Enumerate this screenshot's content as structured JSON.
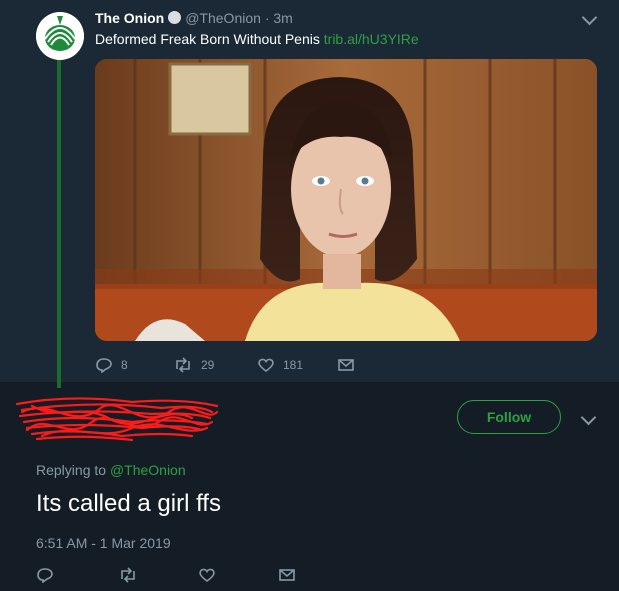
{
  "parent_tweet": {
    "author_name": "The Onion",
    "author_handle": "@TheOnion",
    "separator": "·",
    "time_ago": "3m",
    "text": "Deformed Freak Born Without Penis",
    "link": "trib.al/hU3YIRe",
    "counts": {
      "replies": "8",
      "retweets": "29",
      "likes": "181"
    },
    "icons": [
      "reply-icon",
      "retweet-icon",
      "like-icon",
      "message-icon",
      "verified-badge-icon",
      "chevron-down-icon"
    ]
  },
  "reply_tweet": {
    "follow_label": "Follow",
    "replying_prefix": "Replying to",
    "replying_handle": "@TheOnion",
    "text": "Its called a girl ffs",
    "timestamp": "6:51 AM - 1 Mar 2019",
    "icons": [
      "reply-icon",
      "retweet-icon",
      "like-icon",
      "message-icon",
      "chevron-down-icon"
    ]
  },
  "colors": {
    "background": "#141d26",
    "parent_background": "#1b2836",
    "accent_green": "#2ea043",
    "muted_text": "#8899a6",
    "redaction_red": "#ff1a1a"
  }
}
